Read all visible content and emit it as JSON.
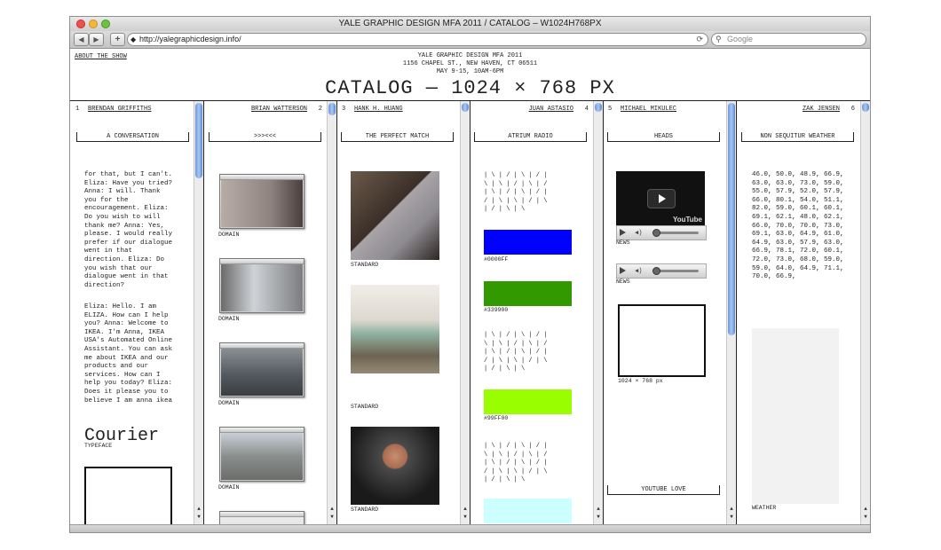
{
  "window": {
    "title": "YALE GRAPHIC DESIGN MFA 2011 / CATALOG – W1024H768PX",
    "url": "http://yalegraphicdesign.info/",
    "search_placeholder": "Google",
    "nav_back": "◀",
    "nav_forward": "▶",
    "add_label": "+",
    "reload_icon": "⟳",
    "search_icon": "🔍"
  },
  "page": {
    "about_link": "ABOUT THE SHOW",
    "header_lines": [
      "YALE GRAPHIC DESIGN MFA 2011",
      "1156 CHAPEL ST., NEW HAVEN, CT 06511",
      "MAY 9-15, 10AM-6PM"
    ],
    "title": "CATALOG — 1024 × 768 PX"
  },
  "columns": [
    {
      "number": "1",
      "artist": "BRENDAN GRIFFITHS",
      "project": "A CONVERSATION",
      "text_blocks": [
        "for that, but I can't. Eliza: Have you tried? Anna: I will. Thank you for the encouragement. Eliza: Do you wish to will thank me? Anna: Yes, please. I would really prefer if our dialogue went in that direction. Eliza: Do you wish that our dialogue went in that direction?",
        "Eliza: Hello. I am ELIZA. How can I help you? Anna: Welcome to IKEA. I'm Anna, IKEA USA's Automated Online Assistant. You can ask me about IKEA and our products and our services. How can I help you today? Eliza: Does it please you to believe I am anna ikea"
      ],
      "typeface_sample": "Courier",
      "typeface_caption": "TYPEFACE"
    },
    {
      "number": "2",
      "artist": "BRIAN WATTERSON",
      "project": ">>><<<",
      "captions": [
        "DOMAIN",
        "DOMAIN",
        "DOMAIN",
        "DOMAIN"
      ]
    },
    {
      "number": "3",
      "artist": "HANK H. HUANG",
      "project": "THE PERFECT MATCH",
      "captions": [
        "STANDARD",
        "STANDARD",
        "STANDARD"
      ]
    },
    {
      "number": "4",
      "artist": "JUAN ASTASIO",
      "project": "ATRIUM RADIO",
      "slash_block_1": "| \\ | / | \\ | / |\n\\ | \\ | / | \\ | /\n| \\ | / | \\ | / |\n/ | \\ | \\ | / | \\\n| / | \\ | \\",
      "slash_block_2": "| \\ | / | \\ | / |\n\\ | \\ | / | \\ | /\n| \\ | / | \\ | / |\n/ | \\ | \\ | / | \\\n| / | \\ | \\",
      "slash_block_3": "| \\ | / | \\ | / |\n\\ | \\ | / | \\ | /\n| \\ | / | \\ | / |\n/ | \\ | \\ | / | \\\n| / | \\ | \\",
      "swatches": [
        {
          "hex": "#0000FF",
          "label": "#0000FF"
        },
        {
          "hex": "#339900",
          "label": "#339900"
        },
        {
          "hex": "#99FF00",
          "label": "#99FF00"
        },
        {
          "hex": "#CCFFFF",
          "label": ""
        }
      ]
    },
    {
      "number": "5",
      "artist": "MICHAEL MIKULEC",
      "project": "HEADS",
      "video_logo": "YouTube",
      "captions": [
        "NEWS",
        "NEWS"
      ],
      "box_caption": "1024 × 768 px",
      "footer_label": "YOUTUBE LOVE"
    },
    {
      "number": "6",
      "artist": "ZAK JENSEN",
      "project": "NON SEQUITUR WEATHER",
      "data_text": "46.0, 50.0, 48.9, 66.9, 63.0, 63.0, 73.0, 59.0, 55.0, 57.9, 52.0, 57.9, 66.0, 80.1, 54.0, 51.1, 82.0, 59.0, 60.1, 60.1, 69.1, 62.1, 48.0, 62.1, 66.0, 70.0, 70.0, 73.0, 69.1, 63.0, 64.9, 61.0, 64.9, 63.0, 57.9, 63.0, 66.9, 78.1, 72.0, 60.1, 72.0, 73.0, 68.0, 59.0, 59.0, 64.0, 64.9, 71.1, 70.0, 66.9,",
      "caption": "WEATHER"
    }
  ]
}
